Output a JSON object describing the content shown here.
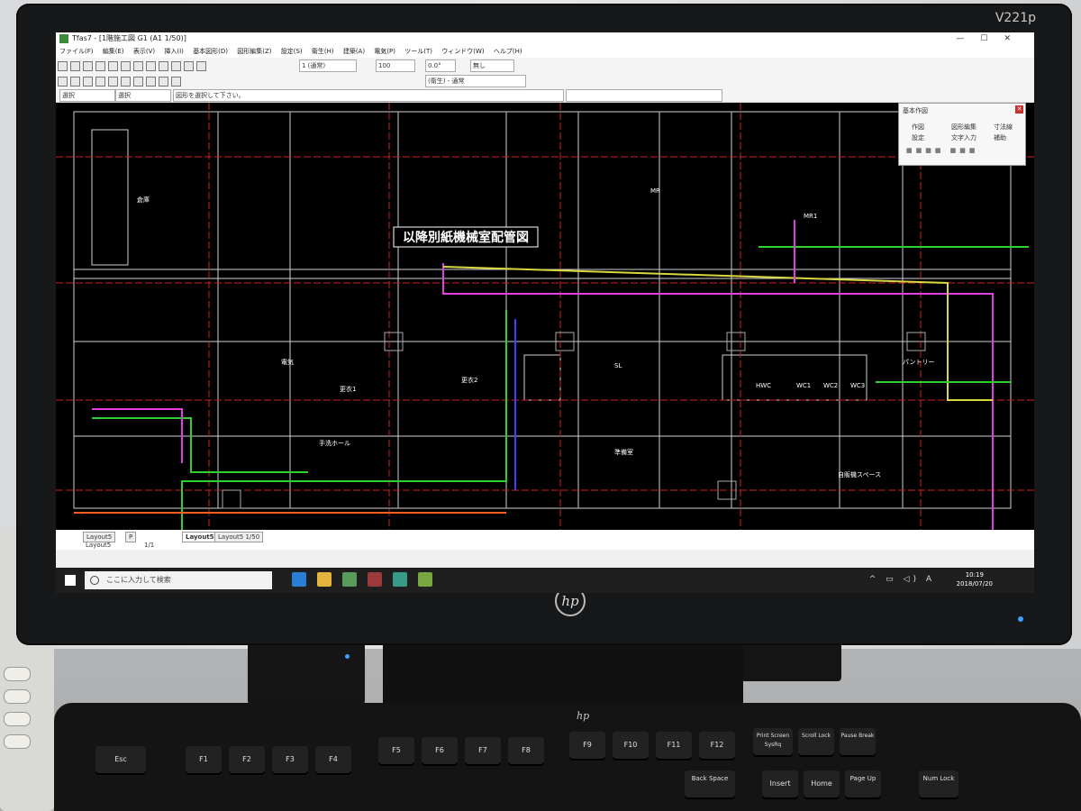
{
  "monitor": {
    "model": "V221p",
    "brand_logo": "hp"
  },
  "window": {
    "title": "Tfas7 - [1階施工図 G1 (A1 1/50)]",
    "controls": [
      "—",
      "☐",
      "✕"
    ]
  },
  "menubar": {
    "items": [
      "ファイル(F)",
      "編集(E)",
      "表示(V)",
      "挿入(I)",
      "基本図形(D)",
      "図形編集(Z)",
      "設定(S)",
      "衛生(H)",
      "建築(A)",
      "電気(P)",
      "ツール(T)",
      "ウィンドウ(W)",
      "ヘルプ(H)"
    ]
  },
  "toolbar": {
    "layer_field": "1 (通常)",
    "scale_field": "100",
    "angle_field": "0.0°",
    "color_field": "無し",
    "linetype_field": "(衛生) - 通常"
  },
  "command_bar": {
    "mode_select": "選択",
    "submode_select": "選択",
    "prompt": "図形を選択して下さい。"
  },
  "panel": {
    "title": "基本作図",
    "buttons": [
      "作図",
      "図形編集",
      "寸法線",
      "設定",
      "文字入力",
      "補助"
    ]
  },
  "drawing": {
    "banner": "以降別紙機械室配管図",
    "room_labels": [
      "倉庫",
      "MR",
      "WC1",
      "WC2",
      "WC3",
      "HWC",
      "更衣1",
      "更衣2",
      "手洗ホール",
      "SL",
      "電気",
      "準備室",
      "自販機スペース",
      "MR1",
      "パントリー"
    ]
  },
  "layout_tabs": {
    "tabs": [
      "Layout5",
      "P",
      "Layout5",
      "Layout5 1/50"
    ],
    "page": "1/1",
    "active": "Layout5"
  },
  "taskbar": {
    "search_placeholder": "ここに入力して検索",
    "time": "10:19",
    "date": "2018/07/20",
    "ime": "A"
  },
  "keyboard": {
    "row1": [
      "Esc",
      "F1",
      "F2",
      "F3",
      "F4",
      "F5",
      "F6",
      "F7",
      "F8",
      "F9",
      "F10",
      "F11",
      "F12",
      "Print Screen SysRq",
      "Scroll Lock",
      "Pause Break"
    ],
    "row2_right": [
      "Back Space",
      "Insert",
      "Home",
      "Page Up",
      "Num Lock"
    ],
    "brand": "hp"
  }
}
